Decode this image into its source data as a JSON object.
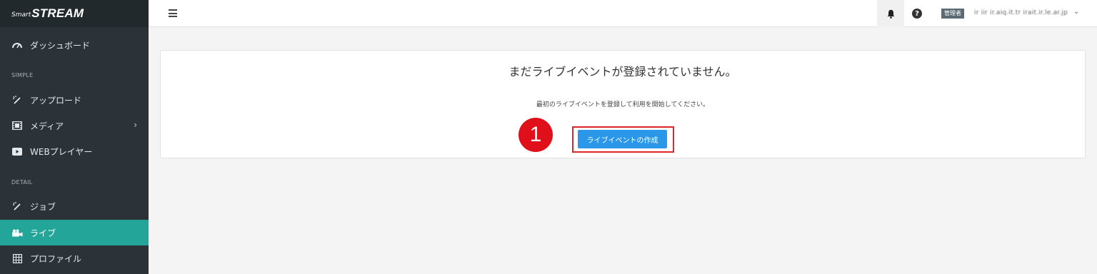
{
  "logo": {
    "prefix": "Smart",
    "name": "STREAM"
  },
  "sidebar": {
    "items": [
      {
        "label": "ダッシュボード",
        "icon": "gauge-icon"
      },
      {
        "label": "アップロード",
        "icon": "magic-wand-icon"
      },
      {
        "label": "メディア",
        "icon": "film-icon"
      },
      {
        "label": "WEBプレイヤー",
        "icon": "play-icon"
      },
      {
        "label": "ジョブ",
        "icon": "magic-wand-icon"
      },
      {
        "label": "ライブ",
        "icon": "video-camera-icon"
      },
      {
        "label": "プロファイル",
        "icon": "grid-icon"
      }
    ],
    "sections": {
      "simple": "SIMPLE",
      "detail": "DETAIL"
    },
    "active_color": "#23a699"
  },
  "header": {
    "role": "管理者",
    "user": "ir iir ir.aiq.it.tr irait.ir.le.ar.jp"
  },
  "main": {
    "title": "まだライブイベントが登録されていません。",
    "subtitle": "最初のライブイベントを登録して利用を開始してください。",
    "create_button": "ライブイベントの作成",
    "step_number": "1",
    "accent_color": "#2b97e8",
    "highlight_color": "#e0262b"
  }
}
